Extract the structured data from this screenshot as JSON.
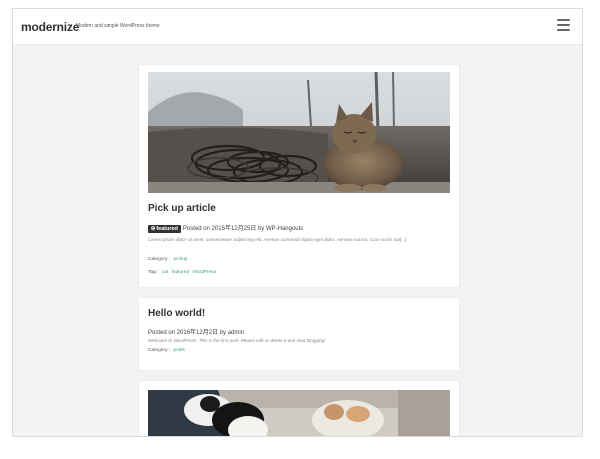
{
  "site": {
    "title": "modernize",
    "tagline": "Modern and simple WordPress theme"
  },
  "menu": {
    "icon": "hamburger-menu-icon"
  },
  "posts": [
    {
      "title": "Pick up article",
      "badge": "featured",
      "badge_icon": "pin-icon",
      "meta": "Posted on 2015年12月25日 by WP-Hangouts",
      "excerpt": "Lorem ipsum dolor sit amet, consectetuer adipiscing elit. Aenean commodo ligula eget dolor. Aenean massa. Cum sociis nat[...]",
      "category_label": "Category :",
      "categories": [
        "pickup"
      ],
      "tag_label": "Tag :",
      "tags": [
        "cat",
        "featured",
        "WordPress"
      ]
    },
    {
      "title": "Hello world!",
      "meta": "Posted on 2016年12月2日 by admin",
      "excerpt": "Welcome to WordPress. This is the first post. Please edit or delete it and start blogging!",
      "category_label": "Category :",
      "categories": [
        "posts"
      ]
    },
    {
      "image": "cat-photo"
    }
  ],
  "colors": {
    "accent_link": "#3e9c7e",
    "badge_bg": "#333333",
    "page_bg": "#f3f3f3"
  }
}
